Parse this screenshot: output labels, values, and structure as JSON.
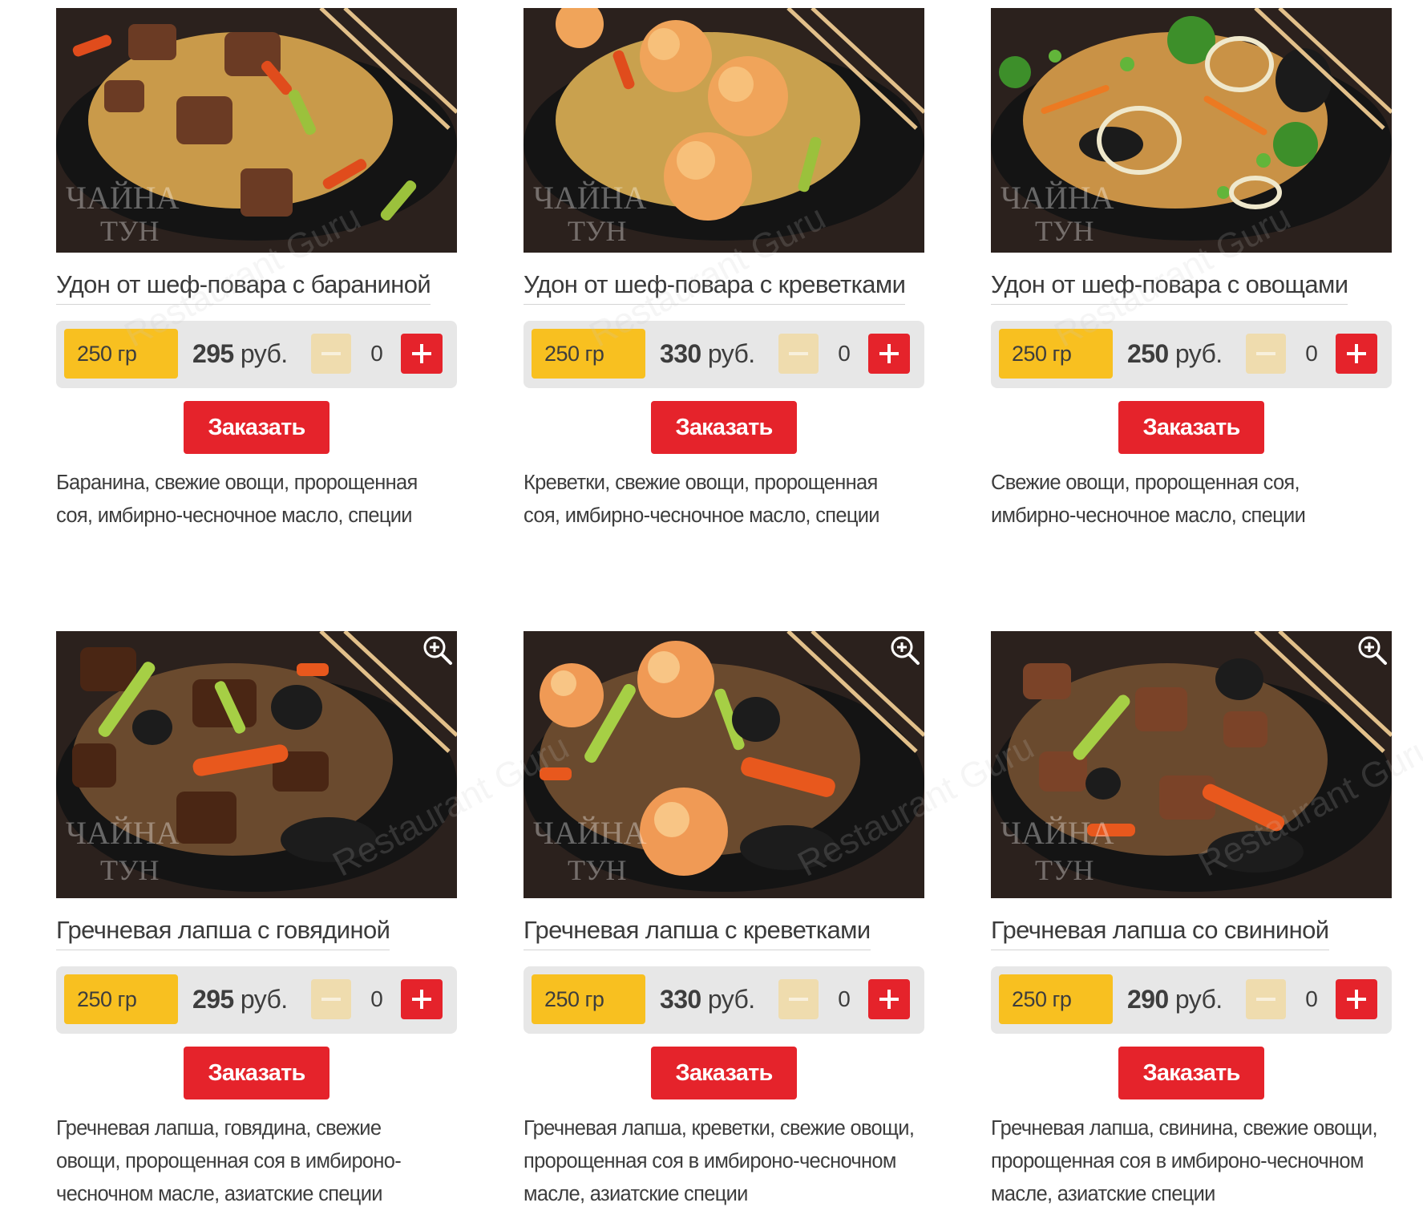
{
  "menu": {
    "items": [
      {
        "title": "Удон от шеф-повара с бараниной",
        "weight": "250 гр",
        "price": "295",
        "currency": "руб.",
        "qty": "0",
        "order_label": "Заказать",
        "desc_lines": [
          "Баранина, свежие овощи, пророщенная",
          "соя, имбирно-чесночное масло, специи"
        ],
        "logo_text": "Чайна Тун"
      },
      {
        "title": "Удон от шеф-повара с креветками",
        "weight": "250 гр",
        "price": "330",
        "currency": "руб.",
        "qty": "0",
        "order_label": "Заказать",
        "desc_lines": [
          "Креветки, свежие овощи, пророщенная",
          "соя, имбирно-чесночное масло, специи"
        ],
        "logo_text": "Чайна Тун"
      },
      {
        "title": "Удон от шеф-повара с овощами",
        "weight": "250 гр",
        "price": "250",
        "currency": "руб.",
        "qty": "0",
        "order_label": "Заказать",
        "desc_lines": [
          "Свежие овощи, пророщенная соя,",
          "имбирно-чесночное масло, специи"
        ],
        "logo_text": "Чайна Тун"
      },
      {
        "title": "Гречневая лапша с говядиной",
        "weight": "250 гр",
        "price": "295",
        "currency": "руб.",
        "qty": "0",
        "order_label": "Заказать",
        "desc_lines": [
          "Гречневая лапша, говядина, свежие",
          "овощи, пророщенная соя в имбироно-",
          "чесночном масле, азиатские специи"
        ],
        "logo_text": "Чайна Тун"
      },
      {
        "title": "Гречневая лапша с креветками",
        "weight": "250 гр",
        "price": "330",
        "currency": "руб.",
        "qty": "0",
        "order_label": "Заказать",
        "desc_lines": [
          "Гречневая лапша, креветки, свежие овощи,",
          "пророщенная соя в имбироно-чесночном",
          "масле, азиатские специи"
        ],
        "logo_text": "Чайна Тун"
      },
      {
        "title": "Гречневая лапша со свининой",
        "weight": "250 гр",
        "price": "290",
        "currency": "руб.",
        "qty": "0",
        "order_label": "Заказать",
        "desc_lines": [
          "Гречневая лапша, свинина, свежие овощи,",
          "пророщенная соя в имбироно-чесночном",
          "масле, азиатские специи"
        ],
        "logo_text": "Чайна Тун"
      }
    ]
  },
  "watermark_text": "Restaurant Guru",
  "colors": {
    "accent_red": "#e5232b",
    "weight_yellow": "#f8c020",
    "minus_beige": "#efdcae",
    "controls_grey": "#e7e7e7"
  },
  "icons": {
    "zoom": "zoom-in-icon",
    "minus": "minus-icon",
    "plus": "plus-icon"
  }
}
